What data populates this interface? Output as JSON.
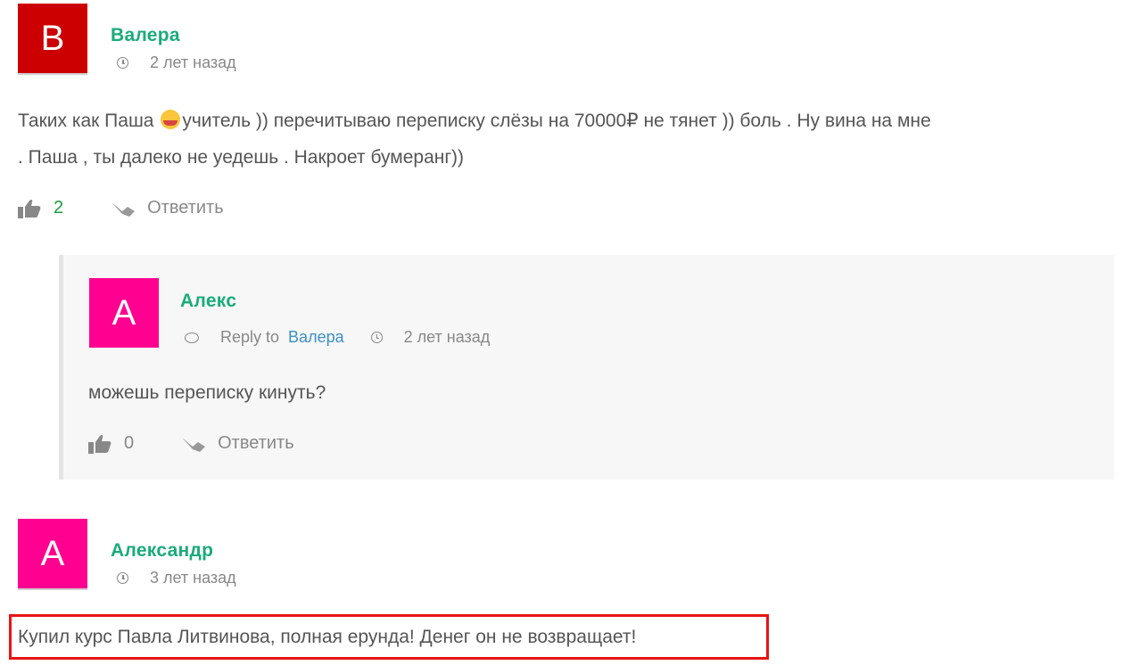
{
  "comments": [
    {
      "avatar_letter": "В",
      "avatar_color": "#cc0000",
      "author": "Валера",
      "time": "2 лет назад",
      "text_before_emoji": "Таких как Паша ",
      "emoji": "joy-emoji",
      "text_after_emoji": "учитель )) перечитываю переписку слёзы на 70000₽ не тянет )) боль . Ну вина на мне",
      "text_line2": ". Паша , ты далеко не уедешь . Накроет бумеранг))",
      "likes": "2",
      "reply_label": "Ответить"
    },
    {
      "avatar_letter": "А",
      "avatar_color": "#ff0090",
      "author": "Алекс",
      "reply_to_label": "Reply to",
      "reply_to_name": "Валера",
      "time": "2 лет назад",
      "text": "можешь переписку кинуть?",
      "likes": "0",
      "reply_label": "Ответить"
    },
    {
      "avatar_letter": "А",
      "avatar_color": "#ff0090",
      "author": "Александр",
      "time": "3 лет назад",
      "text": "Купил курс Павла Литвинова, полная ерунда! Денег он не возвращает!"
    }
  ],
  "highlight_color": "#e81313"
}
